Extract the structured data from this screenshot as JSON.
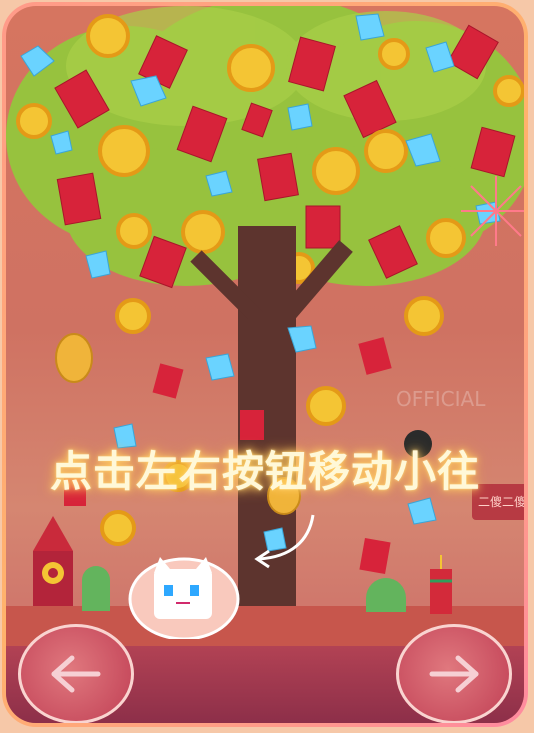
{
  "game": {
    "caption": "点击左右按钮移动小往",
    "side_sign": "二傻二傻",
    "watermark": "OFFICIAL"
  },
  "controls": {
    "left_icon": "arrow-left-icon",
    "right_icon": "arrow-right-icon"
  },
  "colors": {
    "frame_gradient_start": "#ff9a8a",
    "tree_green": "#8cc23a",
    "trunk": "#5d342e",
    "red_envelope": "#d7233a",
    "coin": "#f4c534",
    "diamond": "#6ad3ff",
    "button": "#c74b5d"
  }
}
